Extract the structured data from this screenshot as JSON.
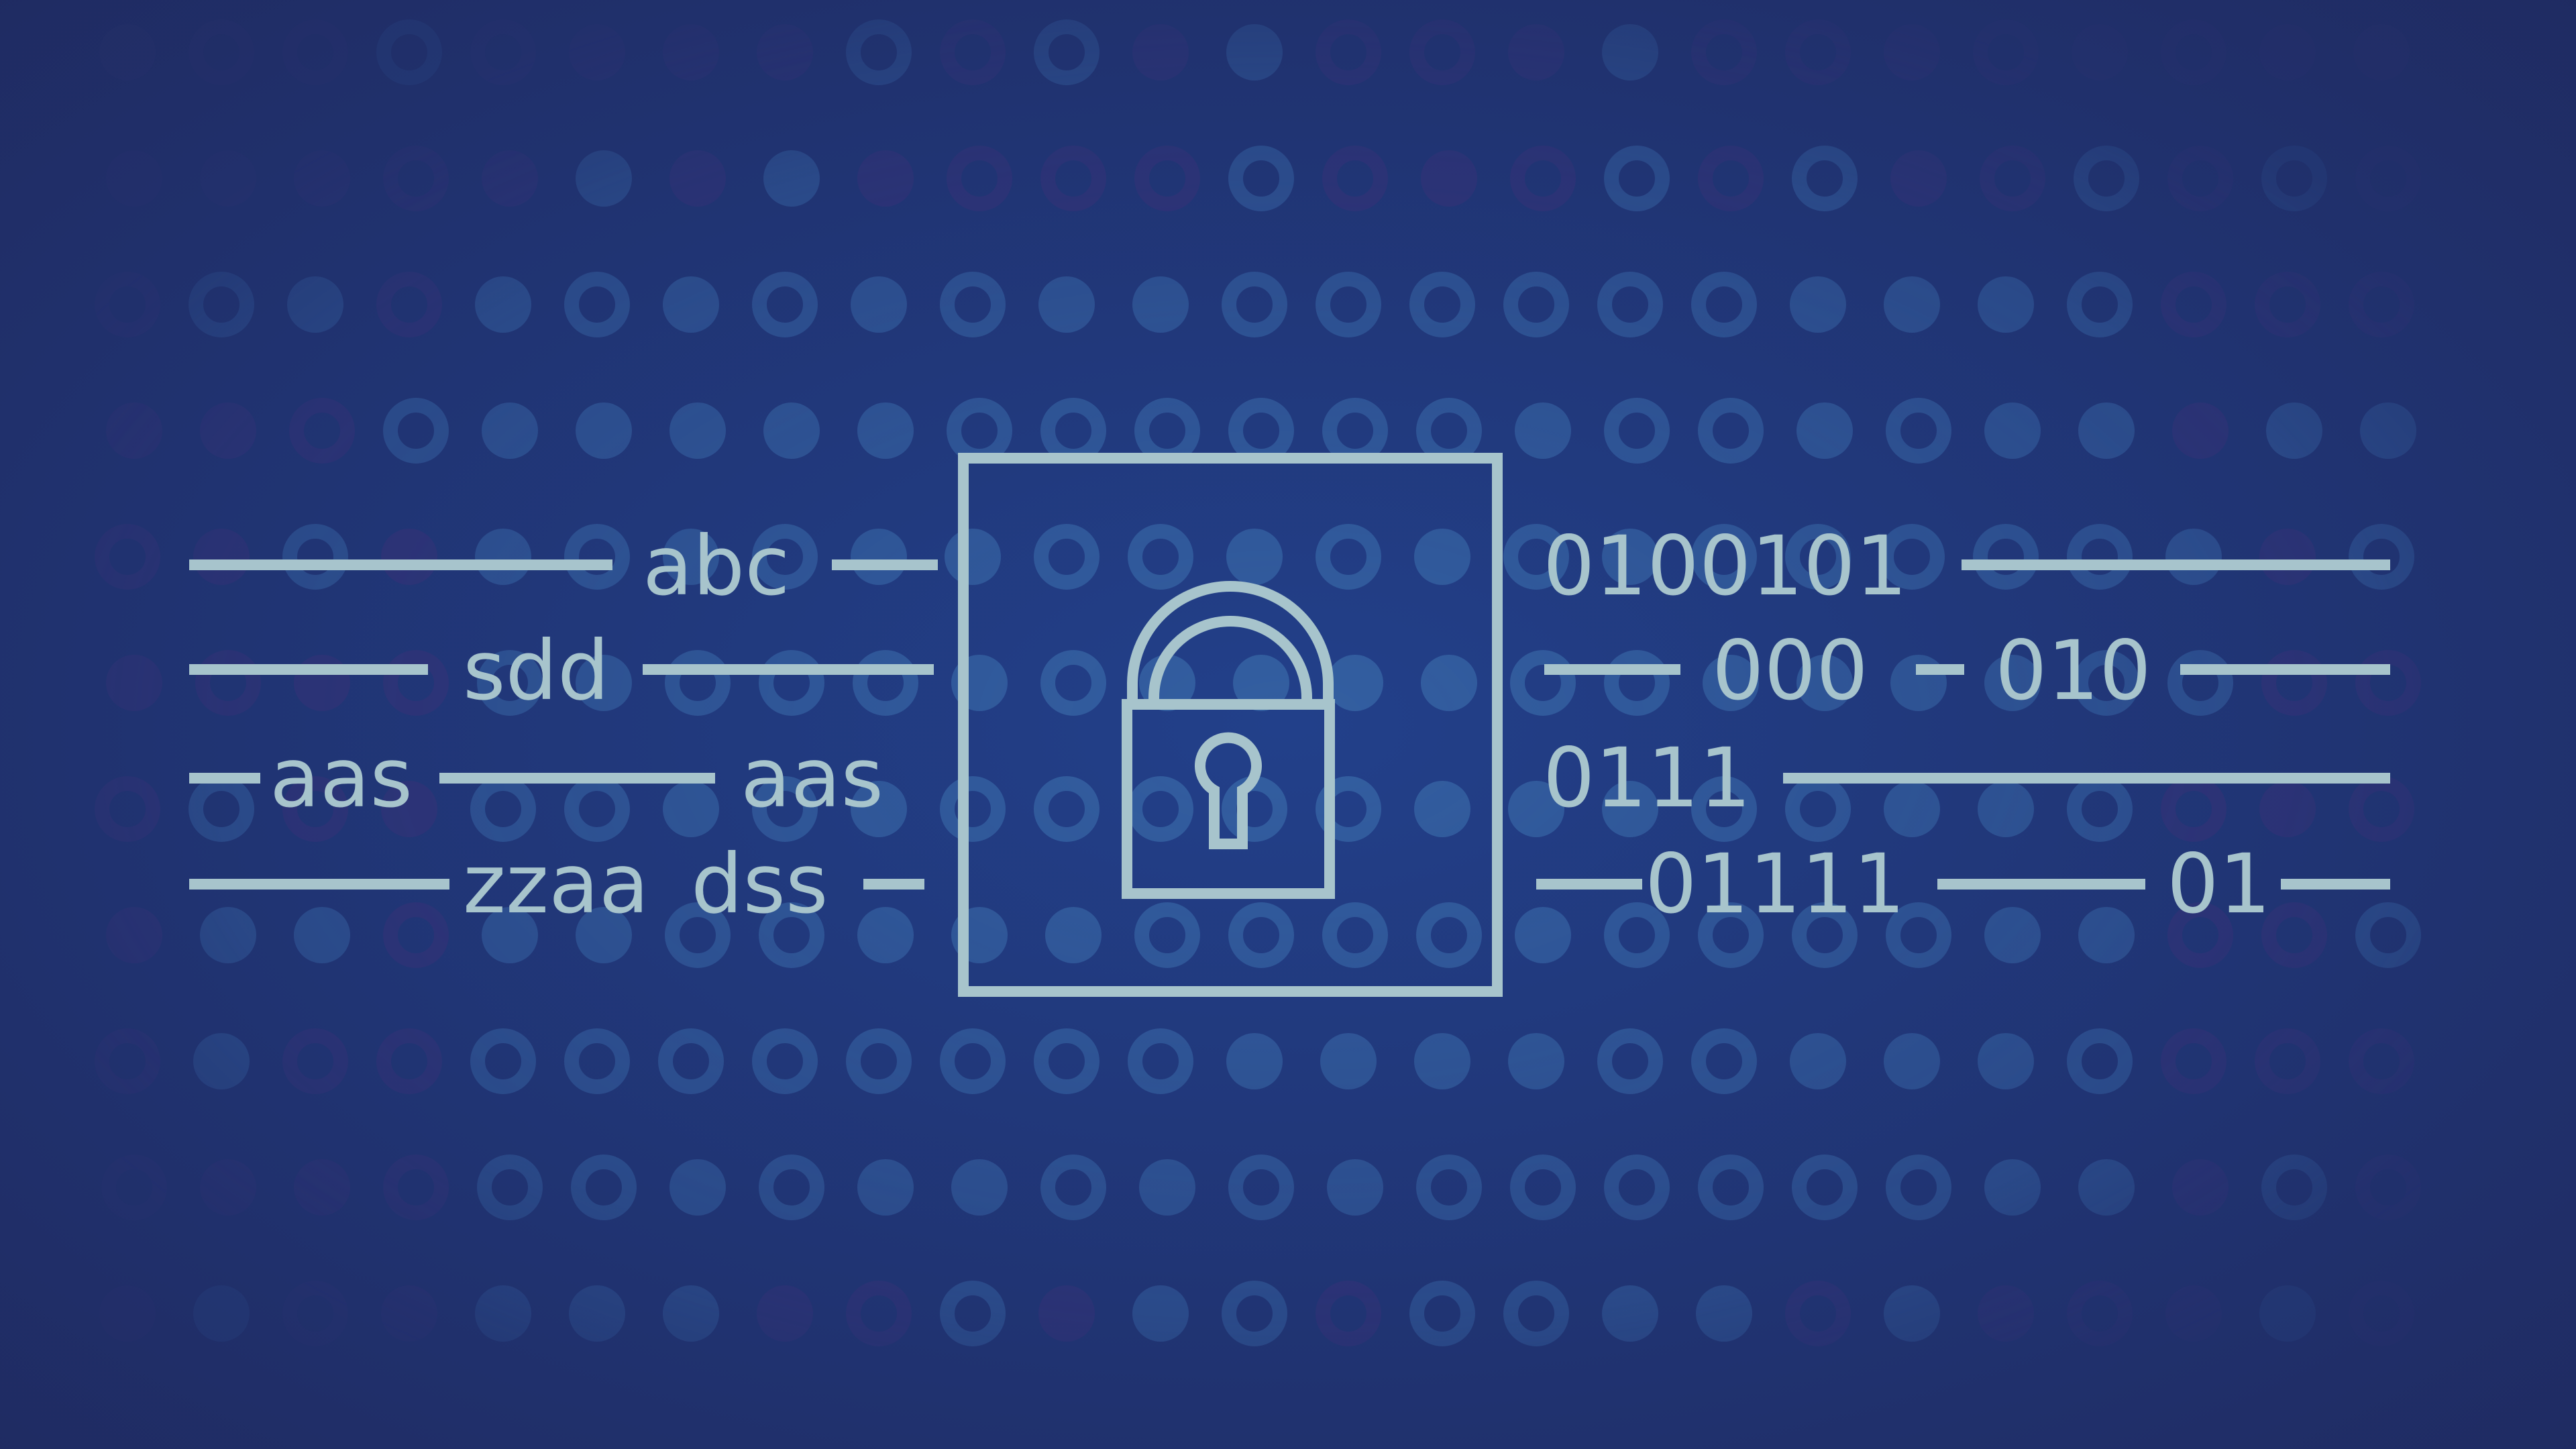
{
  "colors": {
    "background_center": "#22408a",
    "background_edge": "#1f2a60",
    "ink": "#a7c4cc",
    "dot_blue": "#3a6aa8",
    "dot_purple": "#3a3278"
  },
  "icons": {
    "center": "padlock-icon",
    "background": "dot-pattern"
  },
  "plaintext_lines": [
    {
      "id": "abc",
      "text": "abc"
    },
    {
      "id": "sdd",
      "text": "sdd"
    },
    {
      "id": "aas-1",
      "text": "aas"
    },
    {
      "id": "aas-2",
      "text": "aas"
    },
    {
      "id": "zzaa",
      "text": "zzaa"
    },
    {
      "id": "dss",
      "text": "dss"
    }
  ],
  "cipher_lines": [
    {
      "id": "0100101",
      "text": "0100101"
    },
    {
      "id": "000",
      "text": "000"
    },
    {
      "id": "010",
      "text": "010"
    },
    {
      "id": "0111",
      "text": "0111"
    },
    {
      "id": "01111",
      "text": "01111"
    },
    {
      "id": "01",
      "text": "01"
    }
  ]
}
